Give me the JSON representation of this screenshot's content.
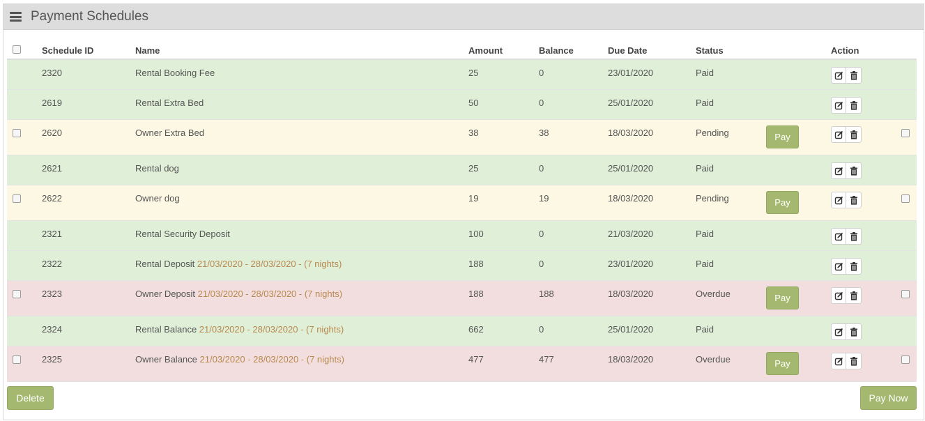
{
  "panel": {
    "title": "Payment Schedules"
  },
  "table": {
    "headers": {
      "schedule_id": "Schedule ID",
      "name": "Name",
      "amount": "Amount",
      "balance": "Balance",
      "due_date": "Due Date",
      "status": "Status",
      "action": "Action"
    },
    "rows": [
      {
        "id": "2320",
        "name": "Rental Booking Fee",
        "dates": "",
        "amount": "25",
        "balance": "0",
        "due": "23/01/2020",
        "status": "Paid"
      },
      {
        "id": "2619",
        "name": "Rental Extra Bed",
        "dates": "",
        "amount": "50",
        "balance": "0",
        "due": "25/01/2020",
        "status": "Paid"
      },
      {
        "id": "2620",
        "name": "Owner Extra Bed",
        "dates": "",
        "amount": "38",
        "balance": "38",
        "due": "18/03/2020",
        "status": "Pending"
      },
      {
        "id": "2621",
        "name": "Rental dog",
        "dates": "",
        "amount": "25",
        "balance": "0",
        "due": "25/01/2020",
        "status": "Paid"
      },
      {
        "id": "2622",
        "name": "Owner dog",
        "dates": "",
        "amount": "19",
        "balance": "19",
        "due": "18/03/2020",
        "status": "Pending"
      },
      {
        "id": "2321",
        "name": "Rental Security Deposit",
        "dates": "",
        "amount": "100",
        "balance": "0",
        "due": "21/03/2020",
        "status": "Paid"
      },
      {
        "id": "2322",
        "name": "Rental Deposit",
        "dates": "21/03/2020 - 28/03/2020 - (7 nights)",
        "amount": "188",
        "balance": "0",
        "due": "23/01/2020",
        "status": "Paid"
      },
      {
        "id": "2323",
        "name": "Owner Deposit",
        "dates": "21/03/2020 - 28/03/2020 - (7 nights)",
        "amount": "188",
        "balance": "188",
        "due": "18/03/2020",
        "status": "Overdue"
      },
      {
        "id": "2324",
        "name": "Rental Balance",
        "dates": "21/03/2020 - 28/03/2020 - (7 nights)",
        "amount": "662",
        "balance": "0",
        "due": "25/01/2020",
        "status": "Paid"
      },
      {
        "id": "2325",
        "name": "Owner Balance",
        "dates": "21/03/2020 - 28/03/2020 - (7 nights)",
        "amount": "477",
        "balance": "477",
        "due": "18/03/2020",
        "status": "Overdue"
      }
    ],
    "pay_label": "Pay"
  },
  "footer": {
    "delete_label": "Delete",
    "pay_now_label": "Pay Now"
  },
  "colors": {
    "paid_row": "#dfefd8",
    "pending_row": "#fcf8e3",
    "overdue_row": "#f2dede",
    "button": "#a4b86f",
    "date_range_text": "#b8894f"
  },
  "icons": {
    "menu": "hamburger-icon",
    "edit": "edit-icon",
    "delete": "trash-icon"
  }
}
